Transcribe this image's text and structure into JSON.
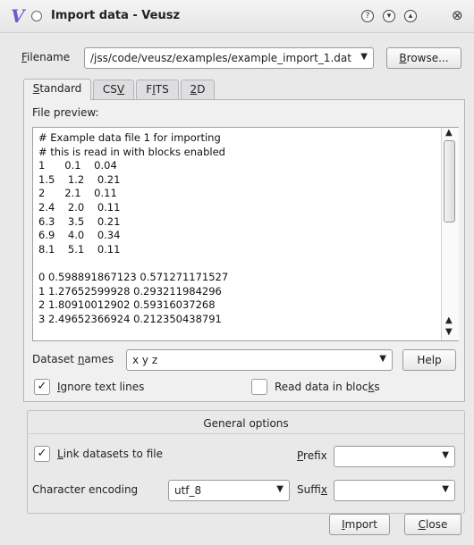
{
  "window": {
    "title": "Import data - Veusz",
    "logo": "V",
    "controls": [
      "question-icon",
      "minimize-icon",
      "maximize-icon",
      "close-icon"
    ],
    "close_glyph": "⊗",
    "help_glyph": "?",
    "min_glyph": "▾",
    "max_glyph": "▴"
  },
  "filename": {
    "label_pre": "",
    "label_u": "F",
    "label_post": "ilename",
    "value": "/jss/code/veusz/examples/example_import_1.dat",
    "browse_pre": "",
    "browse_u": "B",
    "browse_post": "rowse..."
  },
  "tabs": [
    {
      "pre": "",
      "u": "S",
      "post": "tandard",
      "active": true
    },
    {
      "pre": "CS",
      "u": "V",
      "post": "",
      "active": false
    },
    {
      "pre": "F",
      "u": "I",
      "post": "TS",
      "active": false
    },
    {
      "pre": "",
      "u": "2",
      "post": "D",
      "active": false
    }
  ],
  "preview": {
    "label": "File preview:",
    "lines": [
      "# Example data file 1 for importing",
      "# this is read in with blocks enabled",
      "1      0.1    0.04",
      "1.5    1.2    0.21",
      "2      2.1    0.11",
      "2.4    2.0    0.11",
      "6.3    3.5    0.21",
      "6.9    4.0    0.34",
      "8.1    5.1    0.11",
      "",
      "0 0.598891867123 0.571271171527",
      "1 1.27652599928 0.293211984296",
      "2 1.80910012902 0.59316037268",
      "3 2.49652366924 0.212350438791"
    ]
  },
  "dataset_names": {
    "label_pre": "Dataset ",
    "label_u": "n",
    "label_post": "ames",
    "value": "x y z",
    "help": "Help"
  },
  "checks": {
    "ignore_pre": "",
    "ignore_u": "I",
    "ignore_post": "gnore text lines",
    "ignore_checked": true,
    "blocks_pre": "Read data in bloc",
    "blocks_u": "k",
    "blocks_post": "s",
    "blocks_checked": false,
    "check_glyph": "✓"
  },
  "general": {
    "title": "General options",
    "link_pre": "",
    "link_u": "L",
    "link_post": "ink datasets to file",
    "link_checked": true,
    "prefix_pre": "",
    "prefix_u": "P",
    "prefix_post": "refix",
    "prefix_value": "",
    "encoding_label": "Character encoding",
    "encoding_value": "utf_8",
    "suffix_pre": "Suffi",
    "suffix_u": "x",
    "suffix_post": "",
    "suffix_value": ""
  },
  "buttons": {
    "import_pre": "",
    "import_u": "I",
    "import_post": "mport",
    "close_pre": "",
    "close_u": "C",
    "close_post": "lose"
  },
  "colors": {
    "accent": "#6a5acd",
    "background": "#e9e9ea"
  }
}
